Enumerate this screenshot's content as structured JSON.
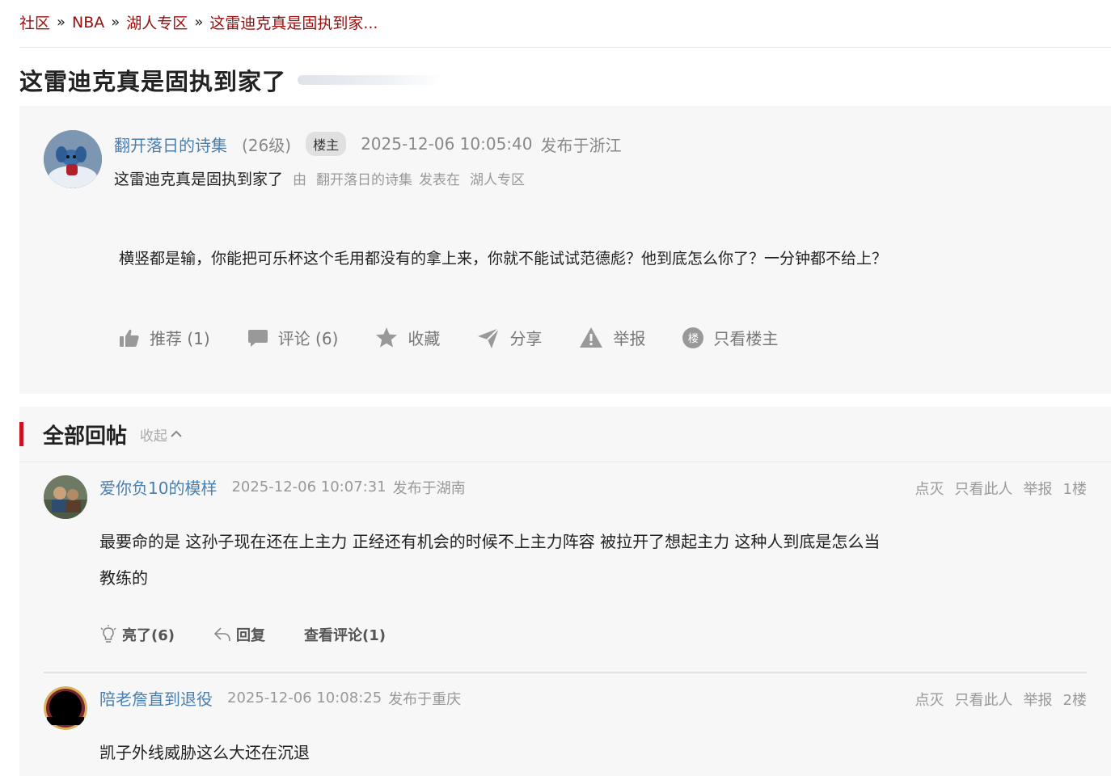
{
  "breadcrumb": {
    "items": [
      "社区",
      "NBA",
      "湖人专区",
      "这雷迪克真是固执到家..."
    ],
    "separator": "»"
  },
  "post": {
    "title": "这雷迪克真是固执到家了",
    "author": "翻开落日的诗集",
    "level": "(26级)",
    "op_badge": "楼主",
    "time": "2025-12-06 10:05:40",
    "location": "发布于浙江",
    "subtitle": "这雷迪克真是固执到家了",
    "by_label": "由",
    "by_author": "翻开落日的诗集",
    "posted_in_label": "发表在",
    "board": "湖人专区",
    "body": "横竖都是输，你能把可乐杯这个毛用都没有的拿上来，你就不能试试范德彪？他到底怎么你了？一分钟都不给上？",
    "actions": {
      "recommend": "推荐 (1)",
      "comment": "评论 (6)",
      "favorite": "收藏",
      "share": "分享",
      "report": "举报",
      "op_only": "只看楼主",
      "op_only_icon_text": "楼"
    }
  },
  "replies_section": {
    "title": "全部回帖",
    "collapse": "收起"
  },
  "replies": [
    {
      "author": "爱你负10的模样",
      "time": "2025-12-06 10:07:31",
      "location": "发布于湖南",
      "dislike": "点灭",
      "only_this": "只看此人",
      "report": "举报",
      "floor": "1楼",
      "text_line1": "最要命的是 这孙子现在还在上主力 正经还有机会的时候不上主力阵容 被拉开了想起主力 这种人到底是怎么当",
      "text_line2": "教练的",
      "light": "亮了(6)",
      "reply": "回复",
      "view_comments": "查看评论(1)"
    },
    {
      "author": "陪老詹直到退役",
      "time": "2025-12-06 10:08:25",
      "location": "发布于重庆",
      "dislike": "点灭",
      "only_this": "只看此人",
      "report": "举报",
      "floor": "2楼",
      "text_line1": "凯子外线威胁这么大还在沉退"
    }
  ],
  "colors": {
    "accent_red": "#c8141e",
    "breadcrumb_red": "#9b0d0d",
    "username_blue": "#4a7fb0",
    "panel_bg": "#f7f7f7"
  }
}
